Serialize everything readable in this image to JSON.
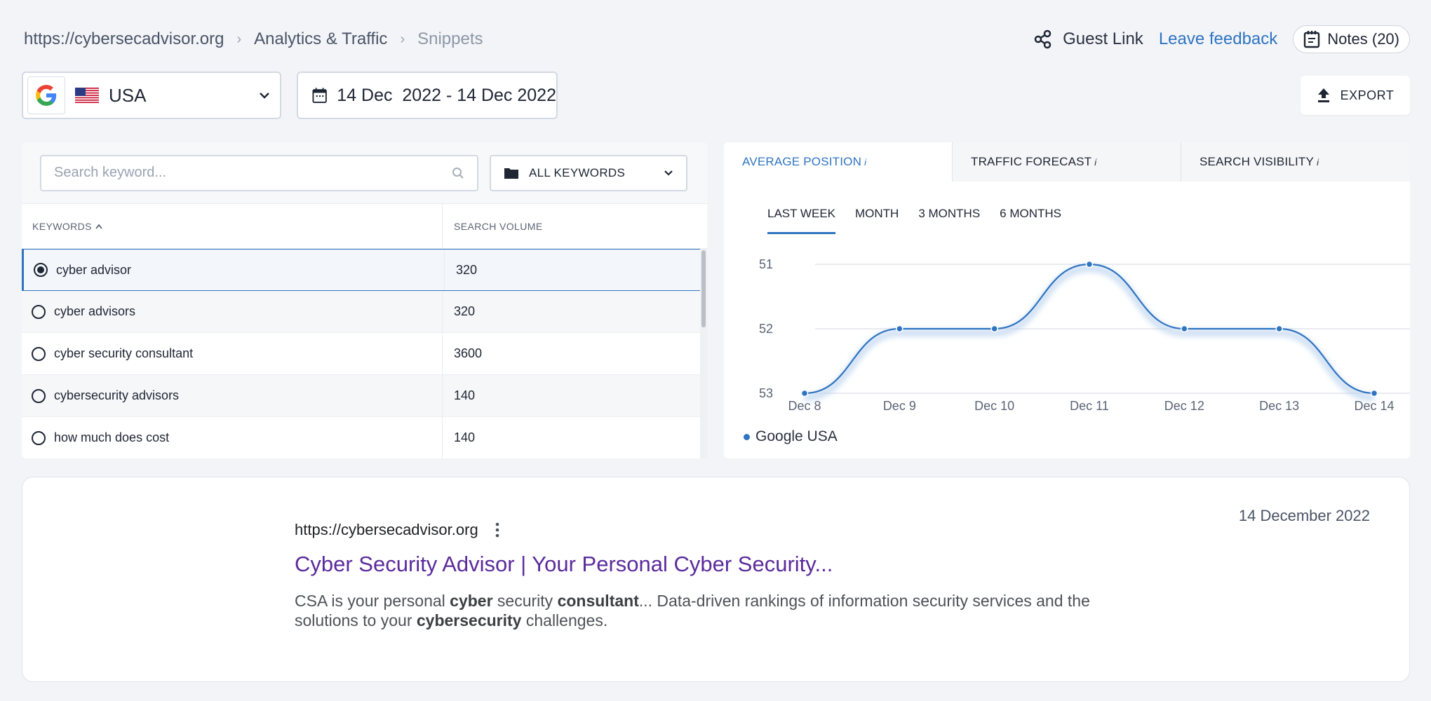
{
  "breadcrumbs": [
    "https://cybersecadvisor.org",
    "Analytics & Traffic",
    "Snippets"
  ],
  "header": {
    "guest_link": "Guest Link",
    "feedback": "Leave feedback",
    "notes": "Notes (20)"
  },
  "filters": {
    "country": "USA",
    "date_range": "14 Dec  2022 - 14 Dec 2022",
    "export": "EXPORT"
  },
  "keywords_panel": {
    "search_placeholder": "Search keyword...",
    "filter_label": "ALL KEYWORDS",
    "columns": [
      "KEYWORDS",
      "SEARCH VOLUME"
    ],
    "rows": [
      {
        "keyword": "cyber advisor",
        "volume": "320",
        "selected": true
      },
      {
        "keyword": "cyber advisors",
        "volume": "320",
        "selected": false
      },
      {
        "keyword": "cyber security consultant",
        "volume": "3600",
        "selected": false
      },
      {
        "keyword": "cybersecurity advisors",
        "volume": "140",
        "selected": false
      },
      {
        "keyword": "how much does cost",
        "volume": "140",
        "selected": false
      }
    ]
  },
  "chart_panel": {
    "tabs": [
      "AVERAGE POSITION",
      "TRAFFIC FORECAST",
      "SEARCH VISIBILITY"
    ],
    "tab_info": "i",
    "periods": [
      "LAST WEEK",
      "MONTH",
      "3 MONTHS",
      "6 MONTHS"
    ],
    "legend": "Google USA"
  },
  "chart_data": {
    "type": "line",
    "x": [
      "Dec 8",
      "Dec 9",
      "Dec 10",
      "Dec 11",
      "Dec 12",
      "Dec 13",
      "Dec 14"
    ],
    "series": [
      {
        "name": "Google USA",
        "values": [
          53,
          52,
          52,
          51,
          52,
          52,
          53
        ]
      }
    ],
    "y_ticks": [
      51,
      52,
      53
    ],
    "ylim": [
      53,
      51
    ],
    "y_inverted": true,
    "grid": true,
    "legend_position": "bottom-left",
    "color": "#2f74c0"
  },
  "snippet": {
    "date": "14 December 2022",
    "url": "https://cybersecadvisor.org",
    "title": "Cyber Security Advisor | Your Personal Cyber Security...",
    "description_parts": [
      {
        "t": "CSA is your personal ",
        "b": false
      },
      {
        "t": "cyber",
        "b": true
      },
      {
        "t": " security ",
        "b": false
      },
      {
        "t": "consultant",
        "b": true
      },
      {
        "t": "... Data-driven rankings of information security services and the solutions to your ",
        "b": false
      },
      {
        "t": "cybersecurity",
        "b": true
      },
      {
        "t": " challenges.",
        "b": false
      }
    ]
  },
  "colors": {
    "accent": "#2f74c0",
    "snippet_title": "#5b2b9c"
  }
}
